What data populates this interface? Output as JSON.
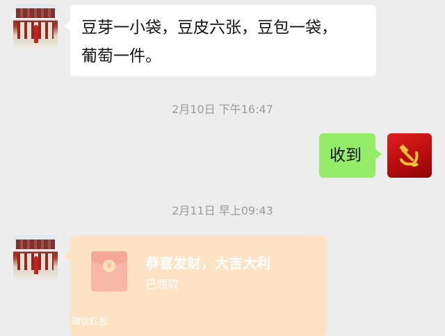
{
  "messages": {
    "first_text": "豆芽一小袋，豆皮六张，豆包一袋，",
    "first_text_line2": "葡萄一件。",
    "time1": "2月10日 下午16:47",
    "reply_text": "收到",
    "time2": "2月11日 早上09:43"
  },
  "red_packet": {
    "title": "恭喜发财，大吉大利",
    "status": "已领取",
    "footer": "微信红包",
    "icon": "red-envelope-icon",
    "color_card": "#fde3c3",
    "color_envelope": "#f8b7a9"
  },
  "colors": {
    "background": "#ededed",
    "bubble_incoming": "#ffffff",
    "bubble_outgoing": "#95ec69",
    "timestamp": "#9a9a9a"
  }
}
